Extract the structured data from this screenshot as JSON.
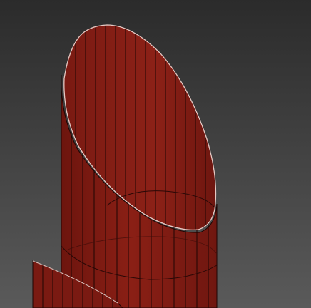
{
  "viewport": {
    "background_top": "#2b2b2b",
    "background_bottom": "#5a5a5a"
  },
  "object": {
    "kind": "cylinder-angled-cut-wireframe-shaded",
    "fill_color": "#7e1a12",
    "fill_color_dark": "#5e120c",
    "inner_color": "#6a150e",
    "edge_color": "#1e0503",
    "rim_highlight": "#e6c9c4"
  }
}
